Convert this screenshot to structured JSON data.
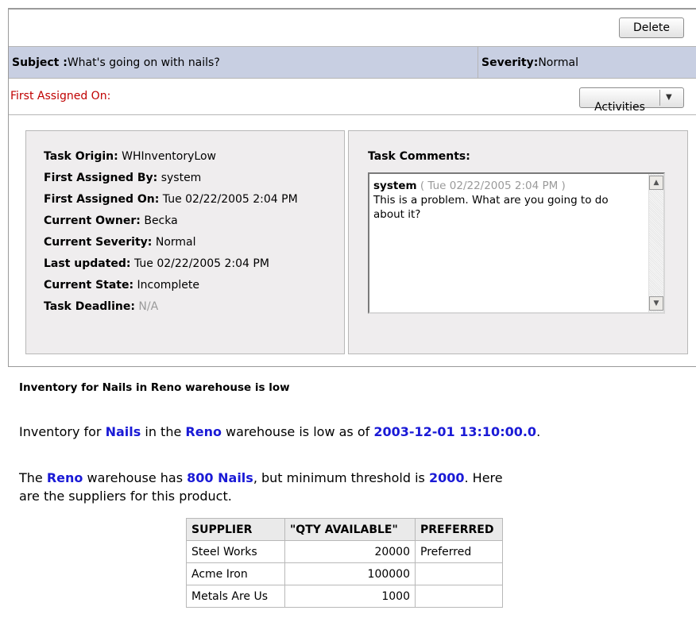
{
  "toolbar": {
    "delete_label": "Delete"
  },
  "subject": {
    "label": "Subject :",
    "value": "What's going on with nails?"
  },
  "severity": {
    "label": "Severity:",
    "value": "Normal"
  },
  "assigned": {
    "label": "First Assigned On:",
    "activities_label": "Activities"
  },
  "details": [
    {
      "label": "Task Origin:",
      "value": "WHInventoryLow"
    },
    {
      "label": "First Assigned By:",
      "value": "system"
    },
    {
      "label": "First Assigned On:",
      "value": "Tue 02/22/2005 2:04 PM"
    },
    {
      "label": "Current Owner:",
      "value": "Becka"
    },
    {
      "label": "Current Severity:",
      "value": "Normal"
    },
    {
      "label": "Last updated:",
      "value": "Tue 02/22/2005 2:04 PM"
    },
    {
      "label": "Current State:",
      "value": "Incomplete"
    },
    {
      "label": "Task Deadline:",
      "value": "N/A"
    }
  ],
  "comments": {
    "title": "Task Comments:",
    "author": "system",
    "timestamp": "( Tue 02/22/2005 2:04 PM )",
    "text": "This is a problem.  What are you going to do about it?"
  },
  "report": {
    "title": "Inventory for Nails in Reno warehouse is low",
    "p1": {
      "t1": "Inventory for ",
      "item": "Nails",
      "t2": " in the ",
      "warehouse": "Reno",
      "t3": " warehouse is low as of ",
      "date": "2003-12-01 13:10:00.0",
      "t4": "."
    },
    "p2": {
      "t1": "The ",
      "warehouse": "Reno",
      "t2": " warehouse has ",
      "qty": "800 Nails",
      "t3": ", but minimum threshold is ",
      "threshold": "2000",
      "t4": ".  Here are the suppliers for this product."
    },
    "table": {
      "headers": [
        "SUPPLIER",
        "\"QTY AVAILABLE\"",
        "PREFERRED"
      ],
      "rows": [
        [
          "Steel Works",
          "20000",
          "Preferred"
        ],
        [
          "Acme Iron",
          "100000",
          ""
        ],
        [
          "Metals Are Us",
          "1000",
          ""
        ]
      ]
    }
  },
  "colors": {
    "subject_bg": "#c8cfe2",
    "alert_label": "#c00000",
    "highlight": "#1a1ad6",
    "panel_bg": "#efedee"
  }
}
